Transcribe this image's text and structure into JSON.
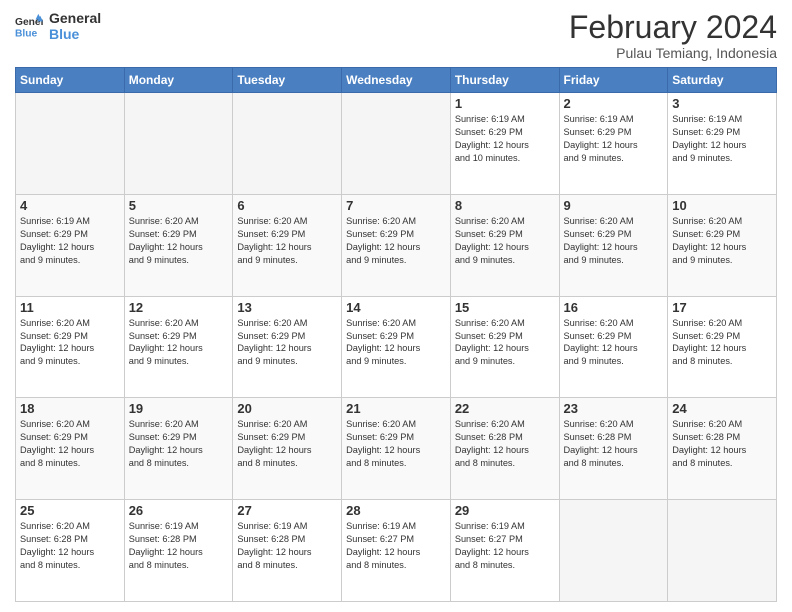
{
  "logo": {
    "line1": "General",
    "line2": "Blue"
  },
  "title": "February 2024",
  "subtitle": "Pulau Temiang, Indonesia",
  "days_of_week": [
    "Sunday",
    "Monday",
    "Tuesday",
    "Wednesday",
    "Thursday",
    "Friday",
    "Saturday"
  ],
  "weeks": [
    [
      {
        "day": "",
        "info": ""
      },
      {
        "day": "",
        "info": ""
      },
      {
        "day": "",
        "info": ""
      },
      {
        "day": "",
        "info": ""
      },
      {
        "day": "1",
        "info": "Sunrise: 6:19 AM\nSunset: 6:29 PM\nDaylight: 12 hours\nand 10 minutes."
      },
      {
        "day": "2",
        "info": "Sunrise: 6:19 AM\nSunset: 6:29 PM\nDaylight: 12 hours\nand 9 minutes."
      },
      {
        "day": "3",
        "info": "Sunrise: 6:19 AM\nSunset: 6:29 PM\nDaylight: 12 hours\nand 9 minutes."
      }
    ],
    [
      {
        "day": "4",
        "info": "Sunrise: 6:19 AM\nSunset: 6:29 PM\nDaylight: 12 hours\nand 9 minutes."
      },
      {
        "day": "5",
        "info": "Sunrise: 6:20 AM\nSunset: 6:29 PM\nDaylight: 12 hours\nand 9 minutes."
      },
      {
        "day": "6",
        "info": "Sunrise: 6:20 AM\nSunset: 6:29 PM\nDaylight: 12 hours\nand 9 minutes."
      },
      {
        "day": "7",
        "info": "Sunrise: 6:20 AM\nSunset: 6:29 PM\nDaylight: 12 hours\nand 9 minutes."
      },
      {
        "day": "8",
        "info": "Sunrise: 6:20 AM\nSunset: 6:29 PM\nDaylight: 12 hours\nand 9 minutes."
      },
      {
        "day": "9",
        "info": "Sunrise: 6:20 AM\nSunset: 6:29 PM\nDaylight: 12 hours\nand 9 minutes."
      },
      {
        "day": "10",
        "info": "Sunrise: 6:20 AM\nSunset: 6:29 PM\nDaylight: 12 hours\nand 9 minutes."
      }
    ],
    [
      {
        "day": "11",
        "info": "Sunrise: 6:20 AM\nSunset: 6:29 PM\nDaylight: 12 hours\nand 9 minutes."
      },
      {
        "day": "12",
        "info": "Sunrise: 6:20 AM\nSunset: 6:29 PM\nDaylight: 12 hours\nand 9 minutes."
      },
      {
        "day": "13",
        "info": "Sunrise: 6:20 AM\nSunset: 6:29 PM\nDaylight: 12 hours\nand 9 minutes."
      },
      {
        "day": "14",
        "info": "Sunrise: 6:20 AM\nSunset: 6:29 PM\nDaylight: 12 hours\nand 9 minutes."
      },
      {
        "day": "15",
        "info": "Sunrise: 6:20 AM\nSunset: 6:29 PM\nDaylight: 12 hours\nand 9 minutes."
      },
      {
        "day": "16",
        "info": "Sunrise: 6:20 AM\nSunset: 6:29 PM\nDaylight: 12 hours\nand 9 minutes."
      },
      {
        "day": "17",
        "info": "Sunrise: 6:20 AM\nSunset: 6:29 PM\nDaylight: 12 hours\nand 8 minutes."
      }
    ],
    [
      {
        "day": "18",
        "info": "Sunrise: 6:20 AM\nSunset: 6:29 PM\nDaylight: 12 hours\nand 8 minutes."
      },
      {
        "day": "19",
        "info": "Sunrise: 6:20 AM\nSunset: 6:29 PM\nDaylight: 12 hours\nand 8 minutes."
      },
      {
        "day": "20",
        "info": "Sunrise: 6:20 AM\nSunset: 6:29 PM\nDaylight: 12 hours\nand 8 minutes."
      },
      {
        "day": "21",
        "info": "Sunrise: 6:20 AM\nSunset: 6:29 PM\nDaylight: 12 hours\nand 8 minutes."
      },
      {
        "day": "22",
        "info": "Sunrise: 6:20 AM\nSunset: 6:28 PM\nDaylight: 12 hours\nand 8 minutes."
      },
      {
        "day": "23",
        "info": "Sunrise: 6:20 AM\nSunset: 6:28 PM\nDaylight: 12 hours\nand 8 minutes."
      },
      {
        "day": "24",
        "info": "Sunrise: 6:20 AM\nSunset: 6:28 PM\nDaylight: 12 hours\nand 8 minutes."
      }
    ],
    [
      {
        "day": "25",
        "info": "Sunrise: 6:20 AM\nSunset: 6:28 PM\nDaylight: 12 hours\nand 8 minutes."
      },
      {
        "day": "26",
        "info": "Sunrise: 6:19 AM\nSunset: 6:28 PM\nDaylight: 12 hours\nand 8 minutes."
      },
      {
        "day": "27",
        "info": "Sunrise: 6:19 AM\nSunset: 6:28 PM\nDaylight: 12 hours\nand 8 minutes."
      },
      {
        "day": "28",
        "info": "Sunrise: 6:19 AM\nSunset: 6:27 PM\nDaylight: 12 hours\nand 8 minutes."
      },
      {
        "day": "29",
        "info": "Sunrise: 6:19 AM\nSunset: 6:27 PM\nDaylight: 12 hours\nand 8 minutes."
      },
      {
        "day": "",
        "info": ""
      },
      {
        "day": "",
        "info": ""
      }
    ]
  ]
}
